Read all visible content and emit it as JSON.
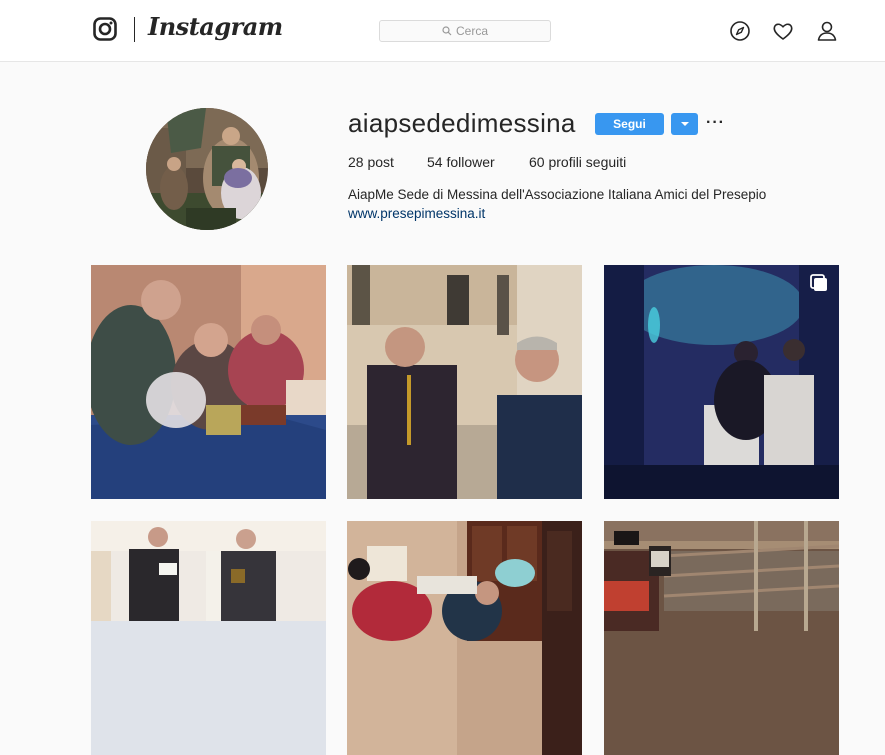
{
  "app": {
    "name": "Instagram"
  },
  "search": {
    "placeholder": "Cerca"
  },
  "nav": {
    "icons": [
      "compass-icon",
      "heart-icon",
      "user-icon"
    ]
  },
  "profile": {
    "username": "aiapsededimessina",
    "follow_label": "Segui",
    "more_label": "···",
    "stats": {
      "posts": "28 post",
      "followers": "54 follower",
      "following": "60 profili seguiti"
    },
    "bio": "AiapMe Sede di Messina dell'Associazione Italiana Amici del Presepio",
    "website": "www.presepimessina.it"
  },
  "colors": {
    "accent": "#3897f0",
    "link": "#003569",
    "background": "#fafafa"
  }
}
